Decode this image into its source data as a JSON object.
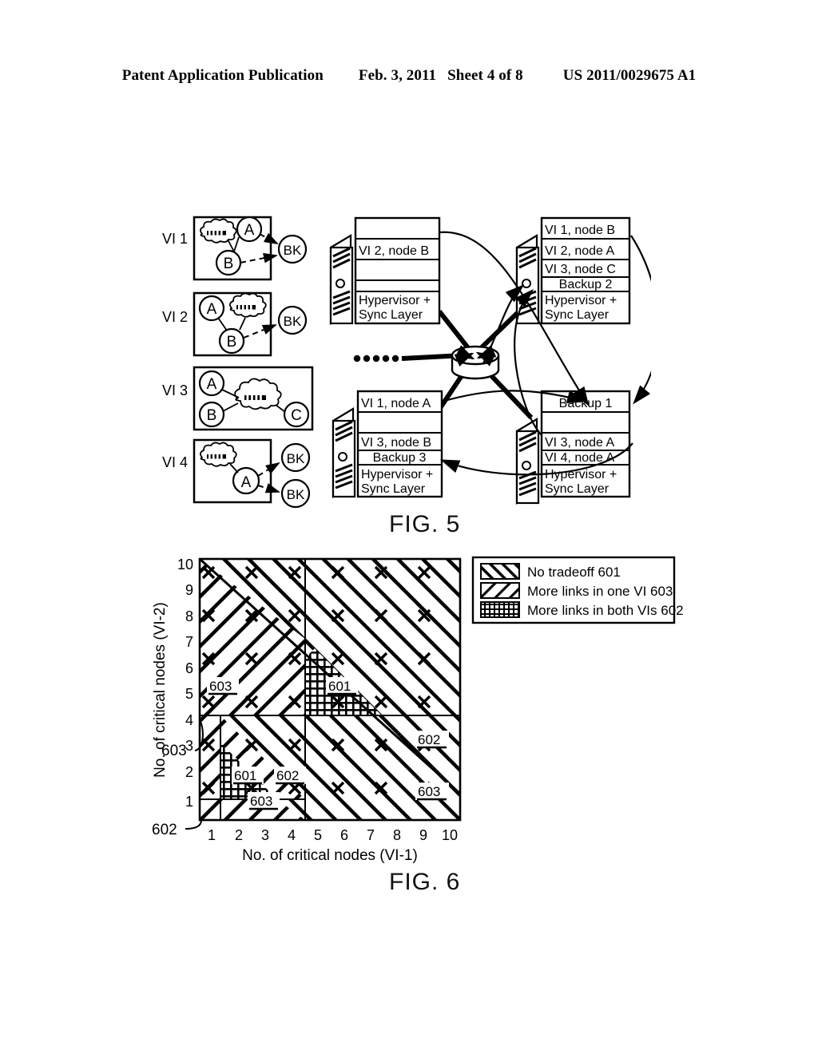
{
  "header": {
    "publication": "Patent Application Publication",
    "date": "Feb. 3, 2011",
    "sheet": "Sheet 4 of 8",
    "pub_number": "US 2011/0029675 A1"
  },
  "fig5": {
    "caption": "FIG. 5",
    "vi_blocks": [
      {
        "label": "VI 1",
        "nodes": [
          "A",
          "B"
        ],
        "cloud": true,
        "backups": [
          "BK"
        ]
      },
      {
        "label": "VI 2",
        "nodes": [
          "A",
          "B"
        ],
        "cloud": true,
        "backups": [
          "BK"
        ]
      },
      {
        "label": "VI 3",
        "nodes": [
          "A",
          "B",
          "C"
        ],
        "cloud": true,
        "backups": []
      },
      {
        "label": "VI 4",
        "nodes": [
          "A"
        ],
        "cloud": true,
        "backups": [
          "BK",
          "BK"
        ]
      }
    ],
    "servers": [
      {
        "id": "server-top-left",
        "rows": [
          "",
          "VI 2, node B",
          "",
          ""
        ],
        "base": "Hypervisor + Sync Layer"
      },
      {
        "id": "server-top-right",
        "rows": [
          "VI 1, node B",
          "VI 2, node A",
          "VI 3, node C",
          "Backup 2"
        ],
        "base": "Hypervisor + Sync Layer"
      },
      {
        "id": "server-bottom-left",
        "rows": [
          "VI 1, node A",
          "",
          "VI 3, node B",
          "Backup 3"
        ],
        "base": "Hypervisor + Sync Layer"
      },
      {
        "id": "server-bottom-right",
        "rows": [
          "Backup 1",
          "",
          "VI 3, node A",
          "VI 4, node A"
        ],
        "base": "Hypervisor + Sync Layer"
      }
    ],
    "network_icon": "router-switch-icon"
  },
  "fig6": {
    "caption": "FIG. 6",
    "callouts": [
      {
        "id": "callout-left-603",
        "text": "603"
      },
      {
        "id": "callout-left-602",
        "text": "602"
      }
    ],
    "region_labels": [
      {
        "id": "region-label-603-upper-left",
        "text": "603"
      },
      {
        "id": "region-label-601-upper",
        "text": "601"
      },
      {
        "id": "region-label-601-lower",
        "text": "601"
      },
      {
        "id": "region-label-602-lower",
        "text": "602"
      },
      {
        "id": "region-label-603-lower",
        "text": "603"
      },
      {
        "id": "region-label-602-right",
        "text": "602"
      },
      {
        "id": "region-label-603-right",
        "text": "603"
      }
    ],
    "chart_data": {
      "type": "heatmap",
      "title": "",
      "xlabel": "No. of critical nodes (VI-1)",
      "ylabel": "No. of critical nodes (VI-2)",
      "xlim": [
        0.5,
        10.5
      ],
      "ylim": [
        0.5,
        10.5
      ],
      "xticks": [
        1,
        2,
        3,
        4,
        5,
        6,
        7,
        8,
        9,
        10
      ],
      "yticks": [
        1,
        2,
        3,
        4,
        5,
        6,
        7,
        8,
        9,
        10
      ],
      "grid": false,
      "legend_position": "top-right",
      "legend": [
        {
          "label": "No tradeoff  601",
          "pattern": "forward-hatch",
          "ref": "601"
        },
        {
          "label": "More links in one VI  603",
          "pattern": "backward-hatch",
          "ref": "603"
        },
        {
          "label": "More links in both VIs  602",
          "pattern": "cross-grid",
          "ref": "602"
        }
      ],
      "regions": [
        {
          "ref": "601",
          "pattern": "cross-grid",
          "name": "No tradeoff",
          "extent": "x 4.5-7.3, y 4.5-7.3 (below anti-diagonal)"
        },
        {
          "ref": "601",
          "pattern": "cross-grid",
          "name": "No tradeoff",
          "extent": "x 1.3-2.6, y 1.3-3.3 (below anti-diagonal)"
        },
        {
          "ref": "603",
          "pattern": "backward-hatch",
          "name": "More links in one VI",
          "extent": "x 0.5-4.5, y 4.5-10.5"
        },
        {
          "ref": "603",
          "pattern": "backward-hatch",
          "name": "More links in one VI",
          "extent": "x 0.5-1.3, y 0.5-4.5"
        },
        {
          "ref": "602",
          "pattern": "forward-hatch",
          "name": "More links in both VIs",
          "extent": "x 4.5-10.5, y 0.5-4.5"
        },
        {
          "ref": "602",
          "pattern": "forward-hatch",
          "name": "More links in both VIs",
          "extent": "x 4.5-10.5, y 4.5-10.5 (above anti-diagonal)"
        },
        {
          "ref": "603",
          "pattern": "backward-hatch",
          "name": "More links in one VI",
          "extent": "x 1.3-4.5, y 1.3-4.5"
        }
      ],
      "boundaries": {
        "anti_diagonal": "y = 11.8 - x",
        "vertical_splits": [
          1.3,
          4.5
        ],
        "horizontal_splits": [
          1.3,
          4.5
        ]
      }
    }
  }
}
